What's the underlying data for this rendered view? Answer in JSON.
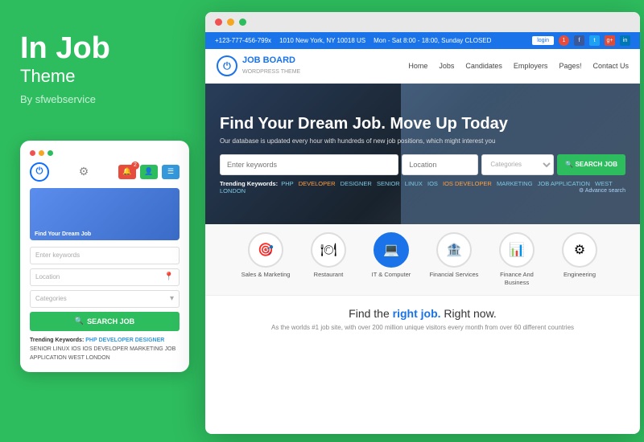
{
  "brand": {
    "title": "In Job",
    "subtitle": "Theme",
    "author": "By sfwebservice"
  },
  "mobile": {
    "dots": [
      "red",
      "yellow",
      "green"
    ],
    "logo_text": "⏻",
    "keywords_placeholder": "Enter keywords",
    "location_placeholder": "Location",
    "categories_placeholder": "Categories",
    "search_btn": "SEARCH JOB",
    "trending_label": "Trending Keywords:",
    "keywords": [
      "PHP",
      "DEVELOPER",
      "DESIGNER",
      "SENIOR",
      "LINUX",
      "IOS",
      "IOS DEVELOPER",
      "MARKETING",
      "JOB APPLICATION",
      "WEST LONDON"
    ]
  },
  "browser": {
    "topbar": {
      "phone": "+123-777-456-799x",
      "address": "1010 New York, NY 10018 US",
      "hours": "Mon - Sat 8:00 - 18:00, Sunday CLOSED",
      "login": "login",
      "notification_count": "1"
    },
    "nav": {
      "logo_text": "JOB BOARD",
      "logo_sub": "WORDPRESS THEME",
      "links": [
        "Home",
        "Jobs",
        "Candidates",
        "Employers",
        "Pages!",
        "Contact Us"
      ]
    },
    "hero": {
      "title": "Find Your Dream Job. Move Up Today",
      "subtitle": "Our database is updated every hour with hundreds of new job positions, which might interest you",
      "keywords_placeholder": "Enter keywords",
      "location_placeholder": "Location",
      "categories_placeholder": "Categories",
      "search_btn": "SEARCH JOB",
      "trending_label": "Trending Keywords:",
      "keywords": [
        "PHP",
        "DEVELOPER",
        "DESIGNER",
        "SENIOR",
        "LINUX",
        "IOS",
        "IOS DEVELOPER",
        "MARKETING",
        "JOB APPLICATION",
        "WEST LONDON"
      ],
      "advance_search": "⚙ Advance search"
    },
    "categories": [
      {
        "icon": "🎯",
        "label": "Sales & Marketing",
        "active": false
      },
      {
        "icon": "🍽",
        "label": "Restaurant",
        "active": false
      },
      {
        "icon": "💻",
        "label": "IT & Computer",
        "active": true
      },
      {
        "icon": "🏦",
        "label": "Financial Services",
        "active": false
      },
      {
        "icon": "📊",
        "label": "Finance And Business",
        "active": false
      },
      {
        "icon": "⚙",
        "label": "Engineering",
        "active": false
      }
    ],
    "bottom": {
      "title_prefix": "Find the ",
      "title_strong": "right job.",
      "title_suffix": " Right now.",
      "description": "As the worlds #1 job site, with over 200 million unique visitors every month from over 60 different countries"
    }
  }
}
